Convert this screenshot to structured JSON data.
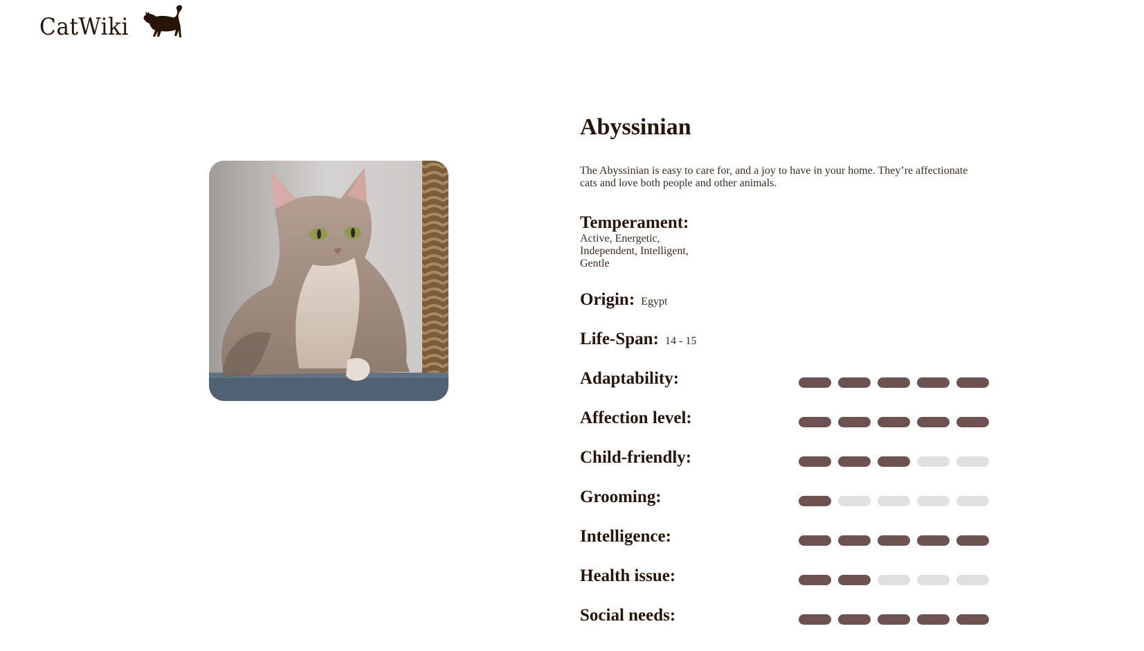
{
  "header": {
    "logo_text": "CatWiki",
    "logo_icon": "cat-silhouette-icon"
  },
  "breed": {
    "name": "Abyssinian",
    "description": "The Abyssinian is easy to care for, and a joy to have in your home. They’re affectionate cats and love both people and other animals.",
    "image_alt": "Abyssinian cat"
  },
  "details": {
    "temperament_label": "Temperament:",
    "temperament_value": "Active, Energetic, Independent, Intelligent, Gentle",
    "origin_label": "Origin:",
    "origin_value": "Egypt",
    "lifespan_label": "Life-Span:",
    "lifespan_value": "14 - 15"
  },
  "ratings": [
    {
      "label": "Adaptability:",
      "value": 5,
      "max": 5
    },
    {
      "label": "Affection level:",
      "value": 5,
      "max": 5
    },
    {
      "label": "Child-friendly:",
      "value": 3,
      "max": 5
    },
    {
      "label": "Grooming:",
      "value": 1,
      "max": 5
    },
    {
      "label": "Intelligence:",
      "value": 5,
      "max": 5
    },
    {
      "label": "Health issue:",
      "value": 2,
      "max": 5
    },
    {
      "label": "Social needs:",
      "value": 5,
      "max": 5
    }
  ],
  "colors": {
    "rating_on": "#6e5252",
    "rating_off": "#e0e0e0",
    "text": "#291507"
  }
}
